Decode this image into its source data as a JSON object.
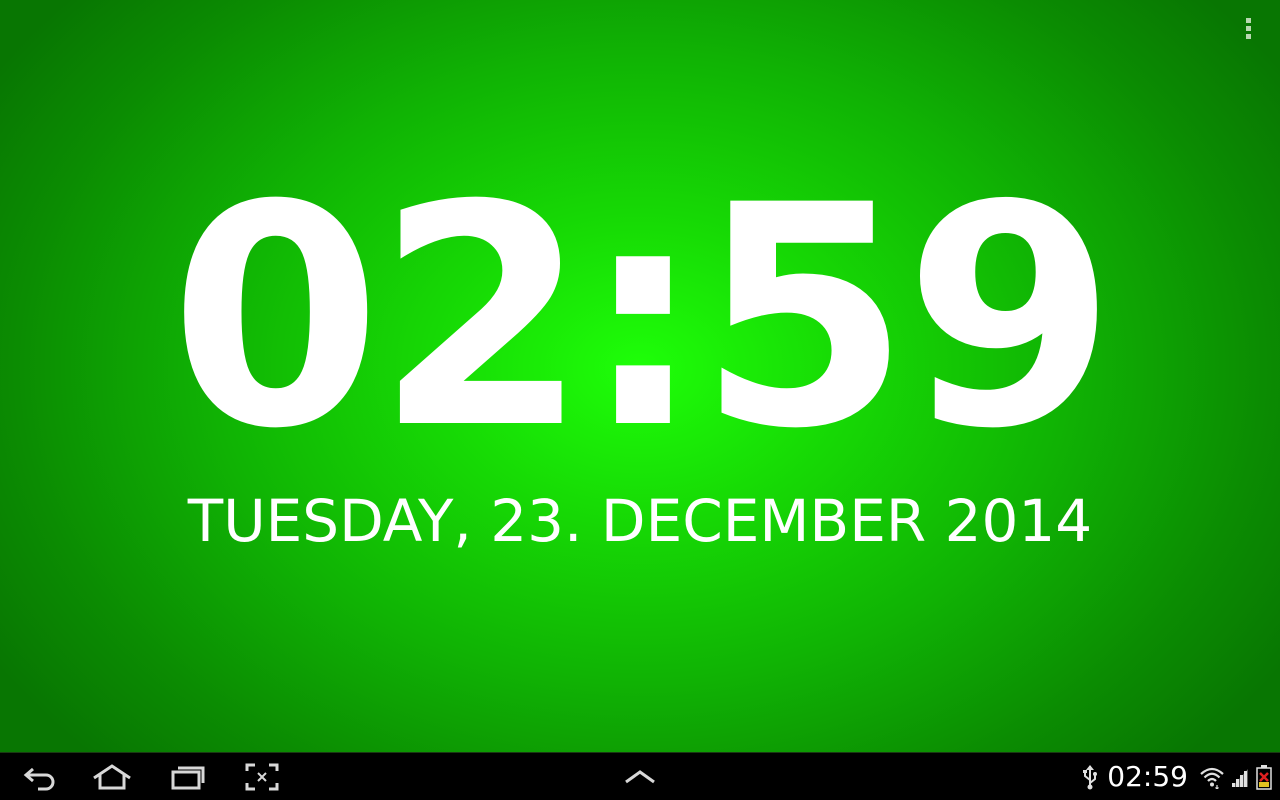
{
  "clock": {
    "time": "02:59",
    "date": "TUESDAY, 23. DECEMBER 2014"
  },
  "action_bar": {
    "overflow_icon": "overflow-menu-icon"
  },
  "navbar": {
    "buttons": [
      {
        "name": "back-button",
        "icon": "back-icon"
      },
      {
        "name": "home-button",
        "icon": "home-icon"
      },
      {
        "name": "recent-apps-button",
        "icon": "recent-apps-icon"
      },
      {
        "name": "screenshot-button",
        "icon": "screenshot-icon"
      },
      {
        "name": "menu-up-button",
        "icon": "chevron-up-icon"
      }
    ],
    "status": {
      "time": "02:59",
      "icons": [
        "usb-icon",
        "wifi-icon",
        "signal-icon",
        "battery-icon"
      ]
    }
  },
  "colors": {
    "background_center": "#1eff08",
    "background_edge": "#087602",
    "text": "#ffffff",
    "navbar": "#000000"
  }
}
